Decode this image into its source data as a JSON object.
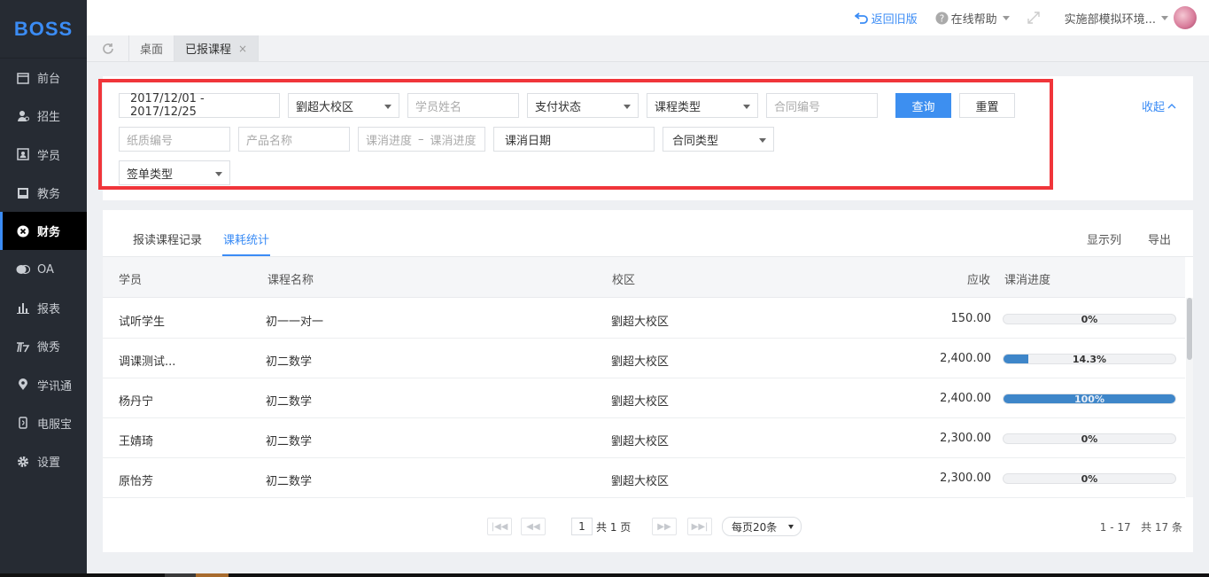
{
  "brand": {
    "logo": "BOSS"
  },
  "sidebar": {
    "items": [
      {
        "label": "前台",
        "icon": "calendar-icon"
      },
      {
        "label": "招生",
        "icon": "user-add-icon"
      },
      {
        "label": "学员",
        "icon": "id-card-icon"
      },
      {
        "label": "教务",
        "icon": "book-icon"
      },
      {
        "label": "财务",
        "icon": "finance-icon",
        "active": true
      },
      {
        "label": "OA",
        "icon": "chat-icon"
      },
      {
        "label": "报表",
        "icon": "bar-chart-icon"
      },
      {
        "label": "微秀",
        "icon": "brand-icon"
      },
      {
        "label": "学讯通",
        "icon": "location-icon"
      },
      {
        "label": "电服宝",
        "icon": "phone-icon"
      },
      {
        "label": "设置",
        "icon": "gear-icon"
      }
    ]
  },
  "header": {
    "back_old": "返回旧版",
    "help": "在线帮助",
    "user": "实施部模拟环境..."
  },
  "page_tabs": {
    "desktop": "桌面",
    "current": "已报课程",
    "close": "×"
  },
  "filters": {
    "date_range": "2017/12/01 - 2017/12/25",
    "campus": "劉超大校区",
    "student_name_ph": "学员姓名",
    "pay_status": "支付状态",
    "course_type": "课程类型",
    "contract_no_ph": "合同编号",
    "paper_no_ph": "纸质编号",
    "product_name_ph": "产品名称",
    "progress_from_ph": "课消进度",
    "progress_sep": "–",
    "progress_to_ph": "课消进度",
    "consume_date": "课消日期",
    "contract_type": "合同类型",
    "sign_type": "签单类型",
    "search_btn": "查询",
    "reset_btn": "重置",
    "collapse": "收起"
  },
  "table_tabs": {
    "tab1": "报读课程记录",
    "tab2": "课耗统计",
    "show_cols": "显示列",
    "export": "导出"
  },
  "table": {
    "headers": {
      "student": "学员",
      "course": "课程名称",
      "campus": "校区",
      "receivable": "应收",
      "progress": "课消进度"
    },
    "rows": [
      {
        "student": "试听学生",
        "course": "初一一对一",
        "campus": "劉超大校区",
        "receivable": "150.00",
        "progress_label": "0%",
        "progress": 0
      },
      {
        "student": "调课测试...",
        "course": "初二数学",
        "campus": "劉超大校区",
        "receivable": "2,400.00",
        "progress_label": "14.3%",
        "progress": 14.3
      },
      {
        "student": "杨丹宁",
        "course": "初二数学",
        "campus": "劉超大校区",
        "receivable": "2,400.00",
        "progress_label": "100%",
        "progress": 100
      },
      {
        "student": "王婧琦",
        "course": "初二数学",
        "campus": "劉超大校区",
        "receivable": "2,300.00",
        "progress_label": "0%",
        "progress": 0
      },
      {
        "student": "原怡芳",
        "course": "初二数学",
        "campus": "劉超大校区",
        "receivable": "2,300.00",
        "progress_label": "0%",
        "progress": 0
      }
    ]
  },
  "pagination": {
    "page": "1",
    "total_pages": "共 1 页",
    "per_page": "每页20条",
    "range": "1 - 17",
    "total": "共 17 条"
  },
  "colors": {
    "accent": "#3b8cf5",
    "highlight": "#f0353a",
    "progress": "#3e86c9",
    "sidebar": "#262b33"
  }
}
